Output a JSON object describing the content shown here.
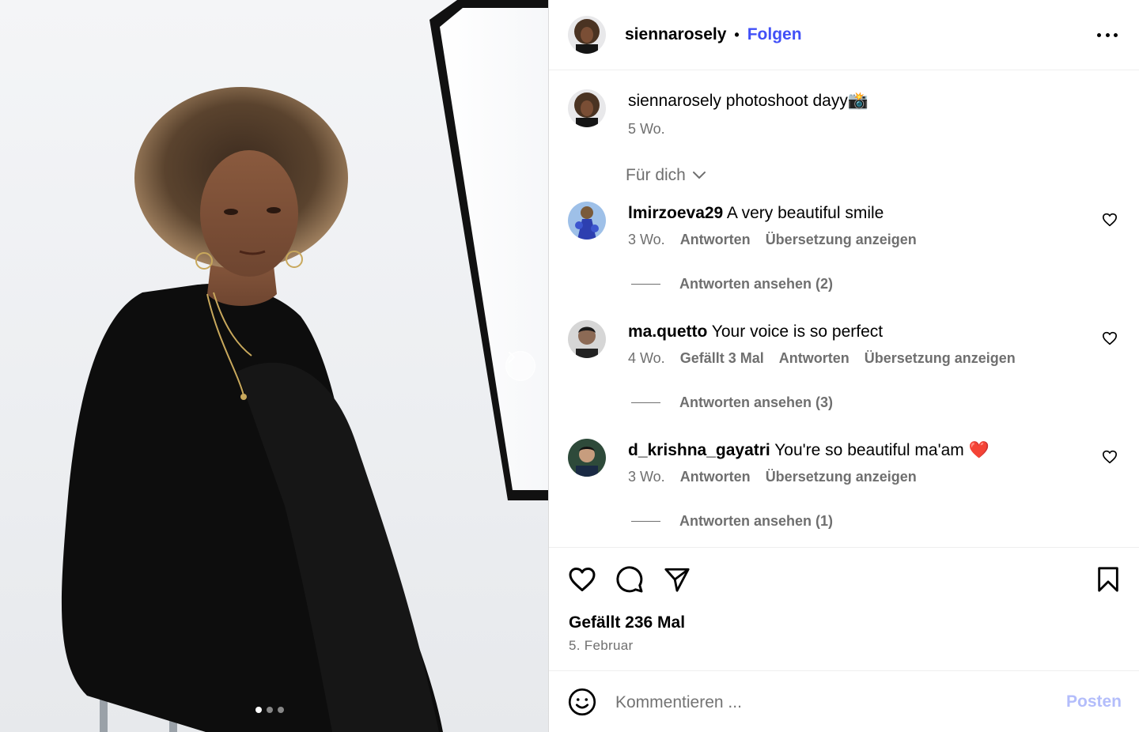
{
  "post": {
    "username": "siennarosely",
    "separator": "•",
    "follow_label": "Folgen"
  },
  "caption": {
    "username": "siennarosely",
    "text": " photoshoot dayy📸",
    "time": "5 Wo."
  },
  "filter": {
    "label": "Für dich"
  },
  "comments": [
    {
      "username": "lmirzoeva29",
      "text": " A very beautiful smile",
      "time": "3 Wo.",
      "reply_label": "Antworten",
      "translate_label": "Übersetzung anzeigen",
      "view_replies": "Antworten ansehen (2)"
    },
    {
      "username": "ma.quetto",
      "text": " Your voice is so perfect",
      "time": "4 Wo.",
      "likes_label": "Gefällt 3 Mal",
      "reply_label": "Antworten",
      "translate_label": "Übersetzung anzeigen",
      "view_replies": "Antworten ansehen (3)"
    },
    {
      "username": "d_krishna_gayatri",
      "text": " You're so beautiful ma'am ❤️",
      "time": "3 Wo.",
      "reply_label": "Antworten",
      "translate_label": "Übersetzung anzeigen",
      "view_replies": "Antworten ansehen (1)"
    }
  ],
  "actions": {
    "likes": "Gefällt 236 Mal",
    "date": "5. Februar"
  },
  "composer": {
    "placeholder": "Kommentieren ...",
    "post_label": "Posten"
  },
  "carousel": {
    "count": 3,
    "active": 1
  },
  "colors": {
    "accent": "#4150f7",
    "muted": "#6f6f6f",
    "post_disabled": "#b3bdfb"
  },
  "icons": [
    "chevron-right-icon",
    "more-icon",
    "chevron-down-icon",
    "heart-icon",
    "comment-icon",
    "share-icon",
    "bookmark-icon",
    "emoji-icon"
  ]
}
